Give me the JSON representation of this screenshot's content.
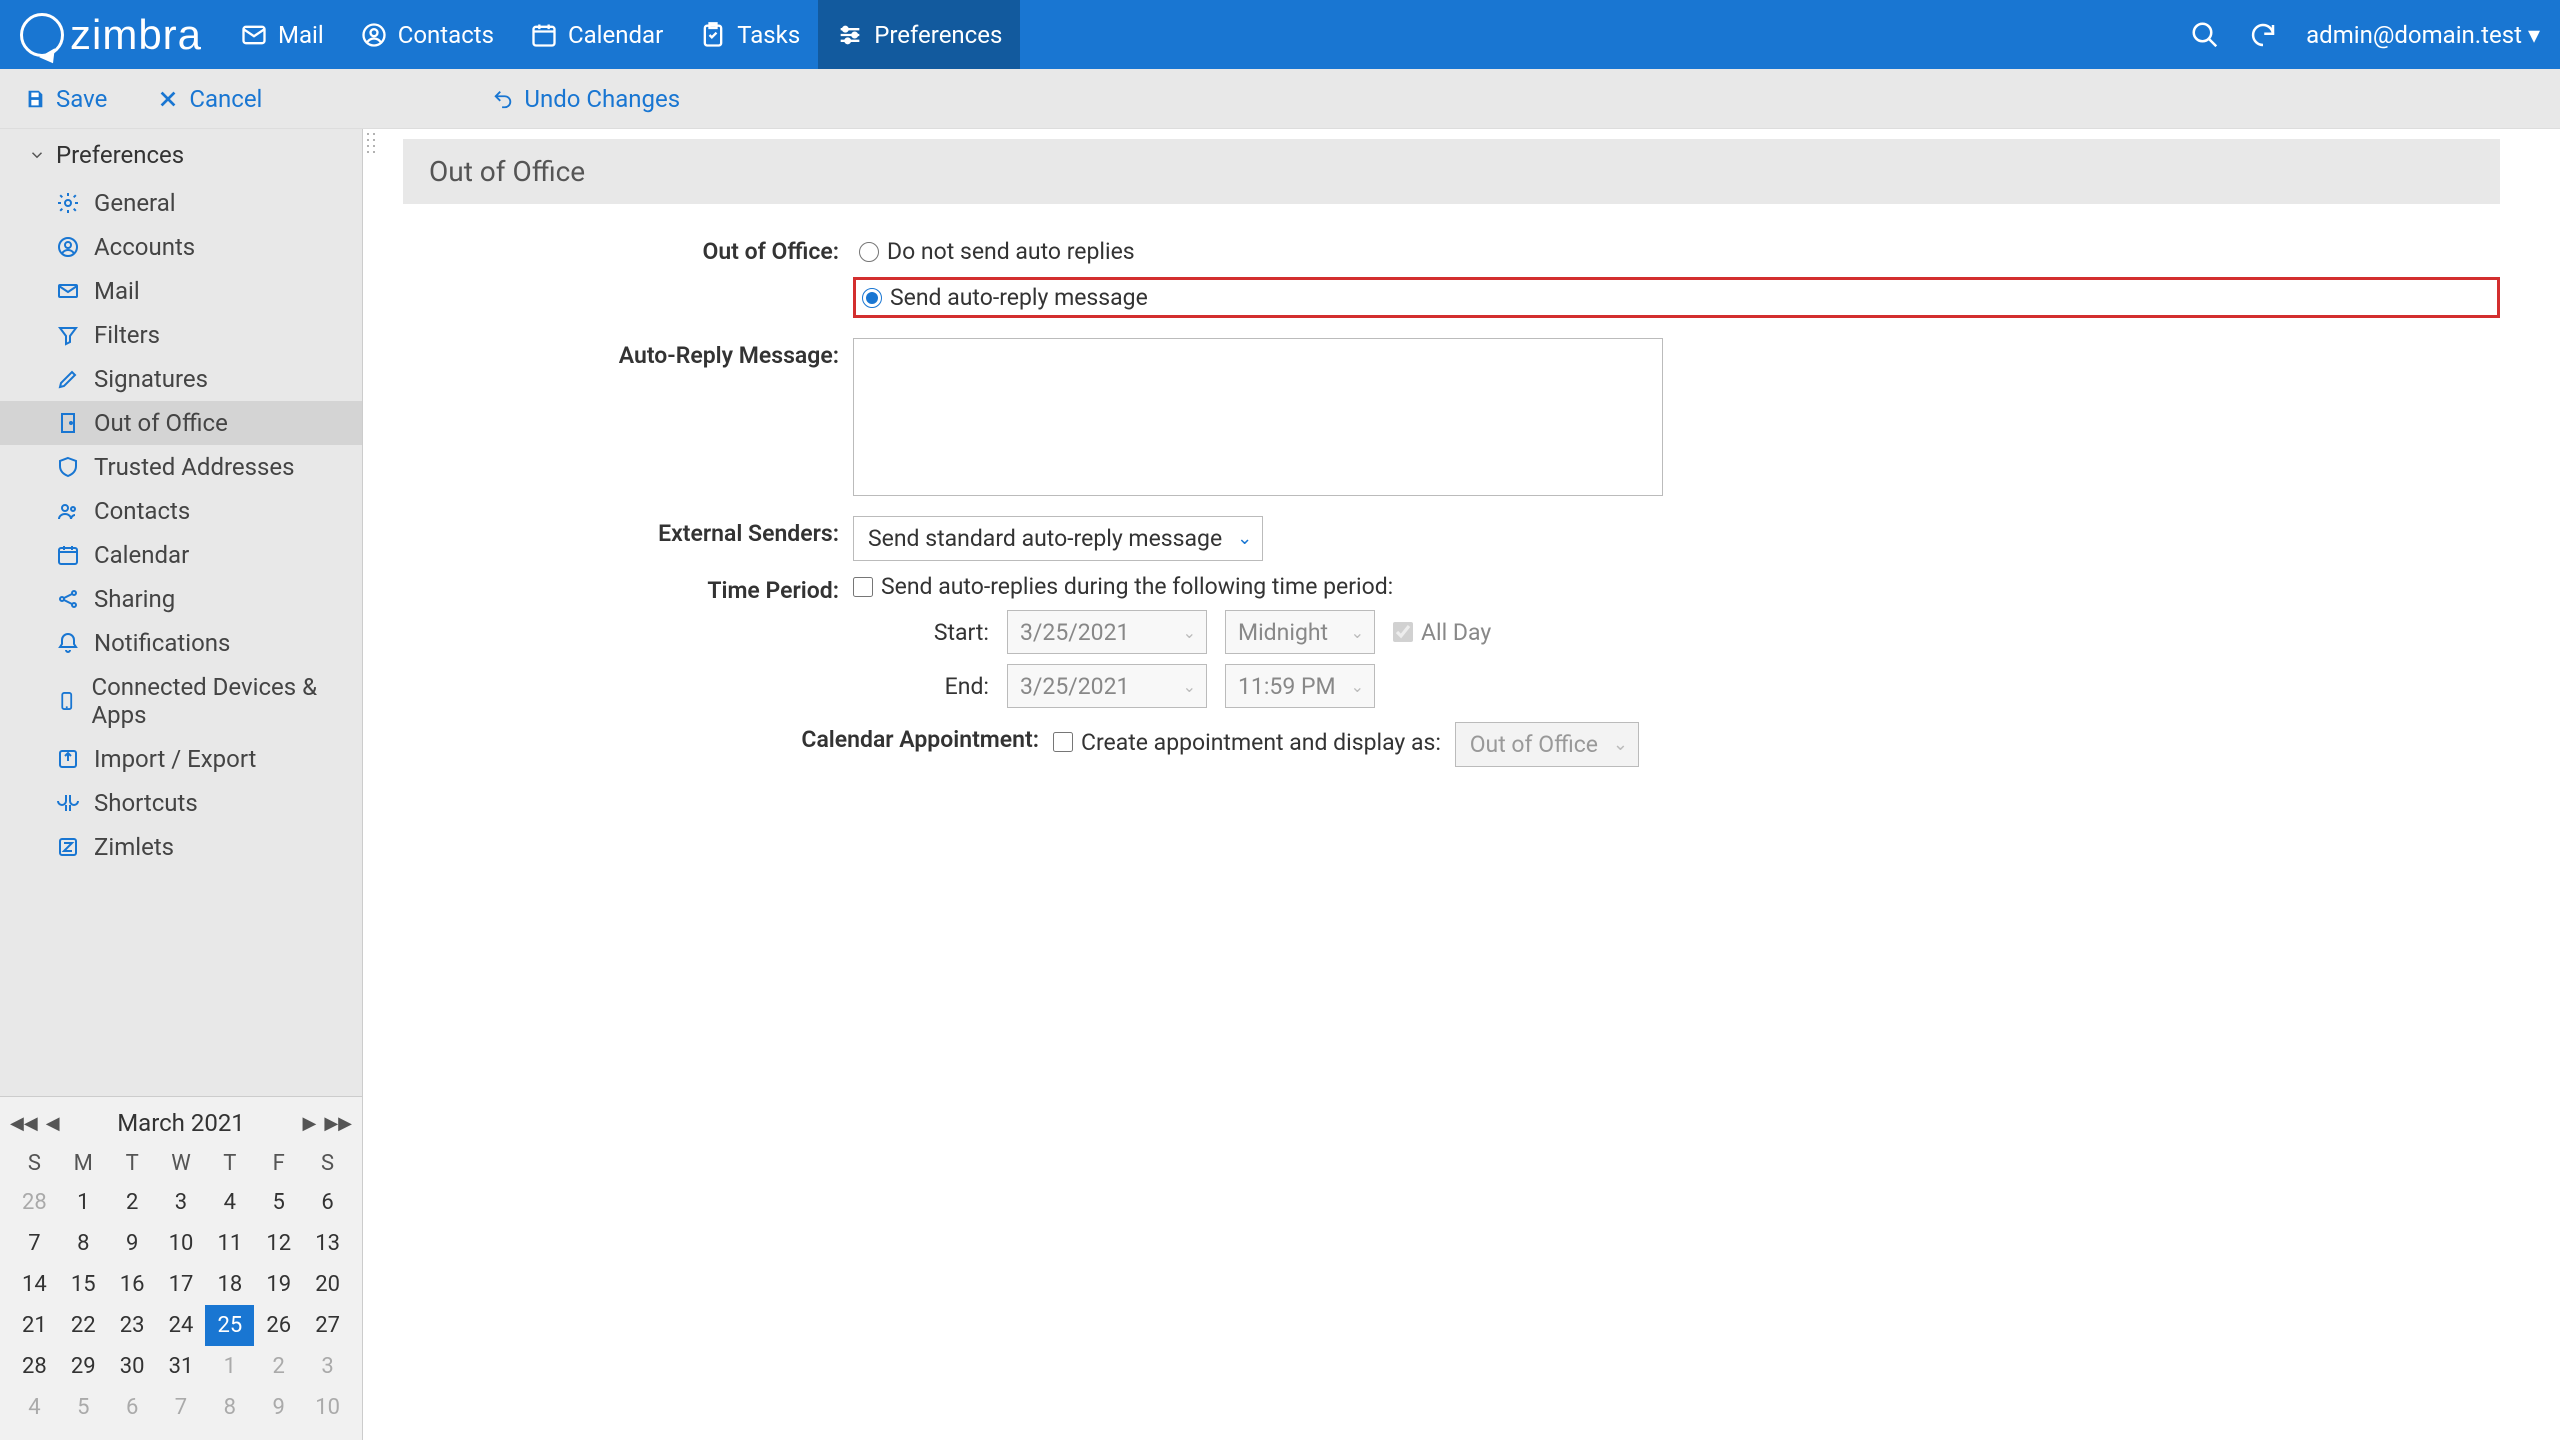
{
  "header": {
    "logo": "zimbra",
    "tabs": [
      {
        "id": "mail",
        "label": "Mail"
      },
      {
        "id": "contacts",
        "label": "Contacts"
      },
      {
        "id": "calendar",
        "label": "Calendar"
      },
      {
        "id": "tasks",
        "label": "Tasks"
      },
      {
        "id": "preferences",
        "label": "Preferences"
      }
    ],
    "user": "admin@domain.test"
  },
  "toolbar": {
    "save": "Save",
    "cancel": "Cancel",
    "undo": "Undo Changes"
  },
  "sidebar": {
    "title": "Preferences",
    "items": [
      {
        "id": "general",
        "label": "General"
      },
      {
        "id": "accounts",
        "label": "Accounts"
      },
      {
        "id": "mail",
        "label": "Mail"
      },
      {
        "id": "filters",
        "label": "Filters"
      },
      {
        "id": "signatures",
        "label": "Signatures"
      },
      {
        "id": "out-of-office",
        "label": "Out of Office"
      },
      {
        "id": "trusted",
        "label": "Trusted Addresses"
      },
      {
        "id": "contacts",
        "label": "Contacts"
      },
      {
        "id": "calendar",
        "label": "Calendar"
      },
      {
        "id": "sharing",
        "label": "Sharing"
      },
      {
        "id": "notifications",
        "label": "Notifications"
      },
      {
        "id": "devices",
        "label": "Connected Devices & Apps"
      },
      {
        "id": "import",
        "label": "Import / Export"
      },
      {
        "id": "shortcuts",
        "label": "Shortcuts"
      },
      {
        "id": "zimlets",
        "label": "Zimlets"
      }
    ]
  },
  "calendar_widget": {
    "month": "March 2021",
    "dow": [
      "S",
      "M",
      "T",
      "W",
      "T",
      "F",
      "S"
    ],
    "days": [
      {
        "n": "28",
        "muted": true
      },
      {
        "n": "1"
      },
      {
        "n": "2"
      },
      {
        "n": "3"
      },
      {
        "n": "4"
      },
      {
        "n": "5"
      },
      {
        "n": "6"
      },
      {
        "n": "7"
      },
      {
        "n": "8"
      },
      {
        "n": "9"
      },
      {
        "n": "10"
      },
      {
        "n": "11"
      },
      {
        "n": "12"
      },
      {
        "n": "13"
      },
      {
        "n": "14"
      },
      {
        "n": "15"
      },
      {
        "n": "16"
      },
      {
        "n": "17"
      },
      {
        "n": "18"
      },
      {
        "n": "19"
      },
      {
        "n": "20"
      },
      {
        "n": "21"
      },
      {
        "n": "22"
      },
      {
        "n": "23"
      },
      {
        "n": "24"
      },
      {
        "n": "25",
        "selected": true
      },
      {
        "n": "26"
      },
      {
        "n": "27"
      },
      {
        "n": "28"
      },
      {
        "n": "29"
      },
      {
        "n": "30"
      },
      {
        "n": "31"
      },
      {
        "n": "1",
        "muted": true
      },
      {
        "n": "2",
        "muted": true
      },
      {
        "n": "3",
        "muted": true
      },
      {
        "n": "4",
        "muted": true
      },
      {
        "n": "5",
        "muted": true
      },
      {
        "n": "6",
        "muted": true
      },
      {
        "n": "7",
        "muted": true
      },
      {
        "n": "8",
        "muted": true
      },
      {
        "n": "9",
        "muted": true
      },
      {
        "n": "10",
        "muted": true
      }
    ]
  },
  "section": {
    "title": "Out of Office",
    "labels": {
      "out_of_office": "Out of Office:",
      "auto_reply_message": "Auto-Reply Message:",
      "external_senders": "External Senders:",
      "time_period": "Time Period:",
      "start": "Start:",
      "end": "End:",
      "calendar_appointment": "Calendar Appointment:",
      "all_day": "All Day"
    },
    "options": {
      "do_not_send": "Do not send auto replies",
      "send_auto_reply": "Send auto-reply message",
      "external_dropdown": "Send standard auto-reply message",
      "time_checkbox": "Send auto-replies during the following time period:",
      "start_date": "3/25/2021",
      "start_time": "Midnight",
      "end_date": "3/25/2021",
      "end_time": "11:59 PM",
      "create_appointment": "Create appointment and display as:",
      "appointment_type": "Out of Office"
    }
  }
}
